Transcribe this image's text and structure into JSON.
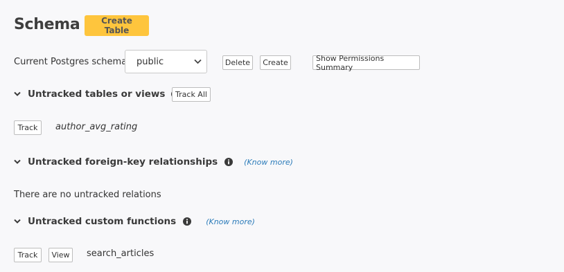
{
  "page": {
    "title": "Schema",
    "create_table_label": "Create Table"
  },
  "schema_bar": {
    "label": "Current Postgres schema",
    "selected_schema": "public",
    "delete_label": "Delete",
    "create_label": "Create",
    "permissions_label": "Show Permissions Summary"
  },
  "untracked_tables": {
    "heading": "Untracked tables or views",
    "track_all_label": "Track All",
    "items": [
      {
        "track_label": "Track",
        "name": "author_avg_rating"
      }
    ]
  },
  "untracked_relationships": {
    "heading": "Untracked foreign-key relationships",
    "know_more": "(Know more)",
    "empty_message": "There are no untracked relations"
  },
  "untracked_functions": {
    "heading": "Untracked custom functions",
    "know_more": "(Know more)",
    "items": [
      {
        "track_label": "Track",
        "view_label": "View",
        "name": "search_articles"
      }
    ]
  },
  "icons": {
    "chevron": "chevron-down-icon",
    "info": "info-circle-icon",
    "select_arrow": "caret-down-icon"
  }
}
